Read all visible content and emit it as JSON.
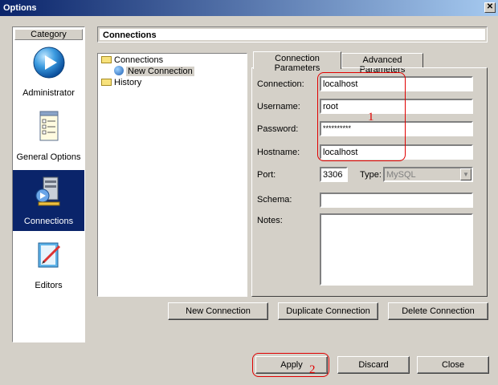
{
  "window": {
    "title": "Options",
    "close_glyph": "✕"
  },
  "sidebar": {
    "header": "Category",
    "items": [
      {
        "label": "Administrator",
        "icon": "play-icon",
        "selected": false
      },
      {
        "label": "General Options",
        "icon": "checklist-icon",
        "selected": false
      },
      {
        "label": "Connections",
        "icon": "server-icon",
        "selected": true
      },
      {
        "label": "Editors",
        "icon": "edit-icon",
        "selected": false
      }
    ]
  },
  "main": {
    "header": "Connections",
    "tree": [
      {
        "label": "Connections",
        "icon": "folder-icon",
        "level": 0
      },
      {
        "label": "New Connection",
        "icon": "globe-icon",
        "level": 1,
        "selected": true
      },
      {
        "label": "History",
        "icon": "folder-icon",
        "level": 0
      }
    ],
    "tabs": [
      {
        "label": "Connection Parameters",
        "active": true
      },
      {
        "label": "Advanced Parameters",
        "active": false
      }
    ],
    "form": {
      "connection_label": "Connection:",
      "connection_value": "localhost",
      "username_label": "Username:",
      "username_value": "root",
      "password_label": "Password:",
      "password_value": "**********",
      "hostname_label": "Hostname:",
      "hostname_value": "localhost",
      "port_label": "Port:",
      "port_value": "3306",
      "type_label": "Type:",
      "type_value": "MySQL",
      "schema_label": "Schema:",
      "schema_value": "",
      "notes_label": "Notes:",
      "notes_value": ""
    },
    "buttons": {
      "new_connection": "New Connection",
      "duplicate_connection": "Duplicate Connection",
      "delete_connection": "Delete Connection"
    }
  },
  "footer": {
    "apply": "Apply",
    "discard": "Discard",
    "close": "Close"
  },
  "annotations": {
    "marker_1": "1",
    "marker_2": "2",
    "color": "#e00000"
  }
}
